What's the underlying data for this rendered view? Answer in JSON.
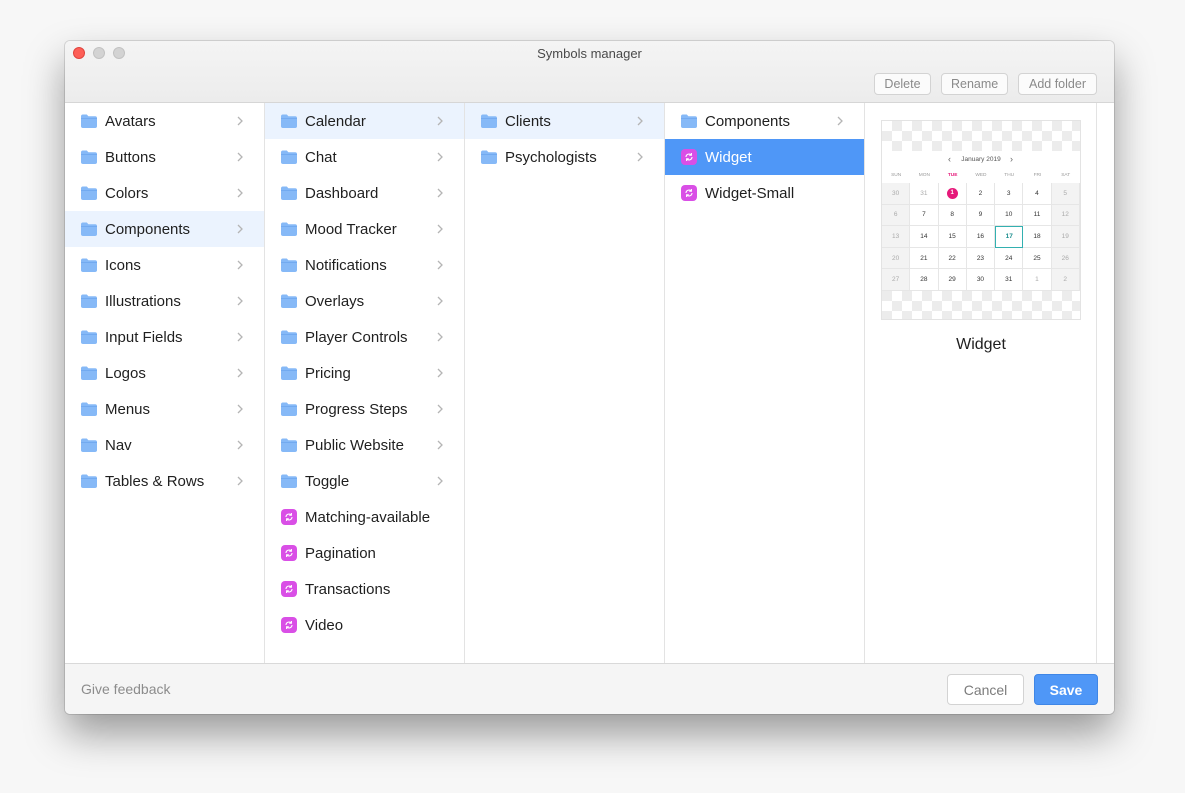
{
  "window": {
    "title": "Symbols manager"
  },
  "toolbar": {
    "delete_label": "Delete",
    "rename_label": "Rename",
    "add_folder_label": "Add folder"
  },
  "columns": {
    "col1": [
      "Avatars",
      "Buttons",
      "Colors",
      "Components",
      "Icons",
      "Illustrations",
      "Input Fields",
      "Logos",
      "Menus",
      "Nav",
      "Tables & Rows"
    ],
    "col2": [
      "Calendar",
      "Chat",
      "Dashboard",
      "Mood Tracker",
      "Notifications",
      "Overlays",
      "Player Controls",
      "Pricing",
      "Progress Steps",
      "Public Website",
      "Toggle",
      "Matching-available",
      "Pagination",
      "Transactions",
      "Video"
    ],
    "col3": [
      "Clients",
      "Psychologists"
    ],
    "col4": [
      "Components",
      "Widget",
      "Widget-Small"
    ]
  },
  "preview": {
    "name": "Widget",
    "calendar": {
      "month": "January 2019",
      "weekdays": [
        "SUN",
        "MON",
        "TUE",
        "WED",
        "THU",
        "FRI",
        "SAT"
      ],
      "rows": [
        [
          "30",
          "31",
          "1",
          "2",
          "3",
          "4",
          "5"
        ],
        [
          "6",
          "7",
          "8",
          "9",
          "10",
          "11",
          "12"
        ],
        [
          "13",
          "14",
          "15",
          "16",
          "17",
          "18",
          "19"
        ],
        [
          "20",
          "21",
          "22",
          "23",
          "24",
          "25",
          "26"
        ],
        [
          "27",
          "28",
          "29",
          "30",
          "31",
          "1",
          "2"
        ]
      ]
    }
  },
  "footer": {
    "feedback_label": "Give feedback",
    "cancel_label": "Cancel",
    "save_label": "Save"
  },
  "colors": {
    "accent": "#4f97f7",
    "folder": "#86b9f7",
    "symbol": "#d94fe6",
    "today": "#e6197a",
    "selected_day": "#33b0b0"
  }
}
